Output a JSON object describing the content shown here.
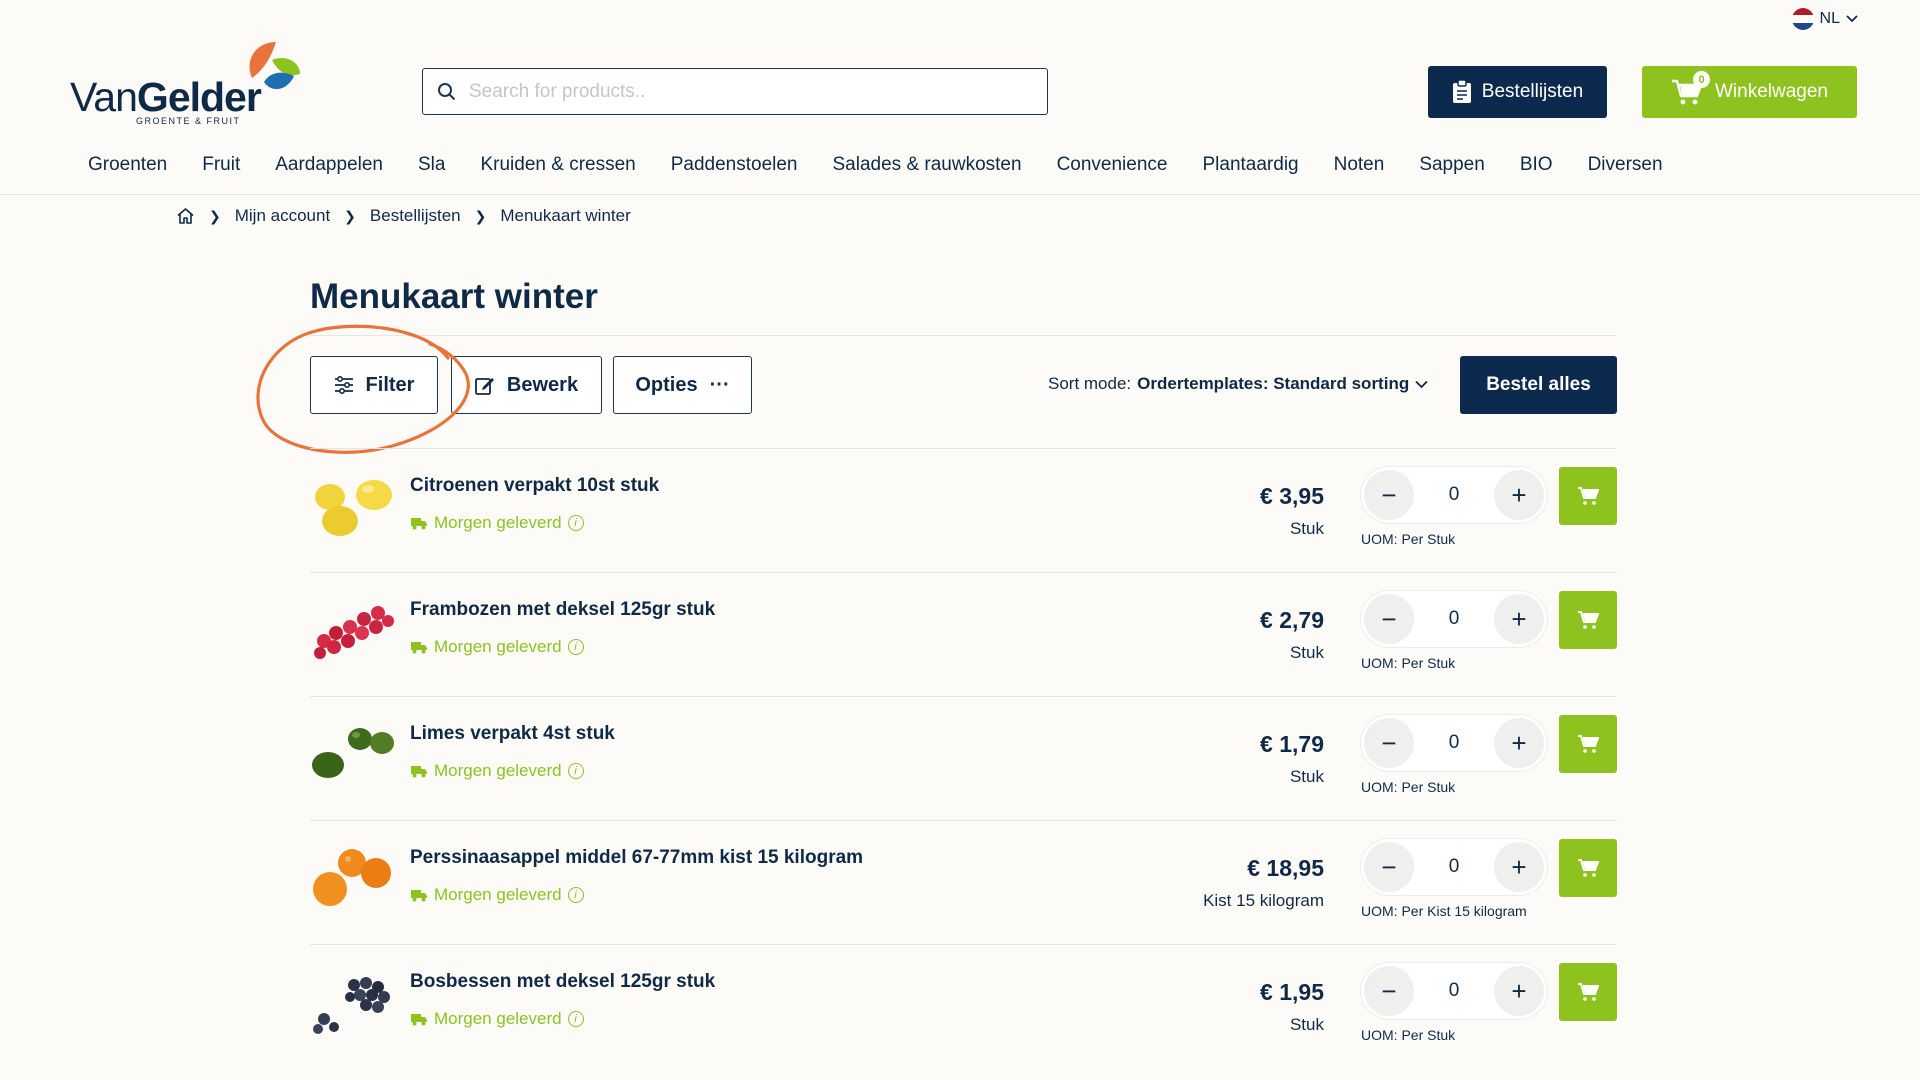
{
  "header": {
    "lang": "NL",
    "logo": {
      "brand_light": "Van",
      "brand_bold": "Gelder",
      "tagline": "GROENTE & FRUIT"
    },
    "search": {
      "placeholder": "Search for products.."
    },
    "orderlists_label": "Bestellijsten",
    "cart_label": "Winkelwagen",
    "cart_count": "0"
  },
  "nav": {
    "items": [
      "Groenten",
      "Fruit",
      "Aardappelen",
      "Sla",
      "Kruiden & cressen",
      "Paddenstoelen",
      "Salades & rauwkosten",
      "Convenience",
      "Plantaardig",
      "Noten",
      "Sappen",
      "BIO",
      "Diversen"
    ]
  },
  "breadcrumb": {
    "items": [
      "Mijn account",
      "Bestellijsten",
      "Menukaart winter"
    ]
  },
  "page": {
    "title": "Menukaart winter",
    "filter_label": "Filter",
    "edit_label": "Bewerk",
    "options_label": "Opties",
    "options_dots": "···",
    "sort_prefix": "Sort mode:",
    "sort_value": "Ordertemplates: Standard sorting",
    "order_all_label": "Bestel alles"
  },
  "products": [
    {
      "name": "Citroenen verpakt 10st stuk",
      "delivery": "Morgen geleverd",
      "price": "€ 3,95",
      "unit": "Stuk",
      "qty": "0",
      "uom": "UOM: Per Stuk"
    },
    {
      "name": "Frambozen met deksel 125gr stuk",
      "delivery": "Morgen geleverd",
      "price": "€ 2,79",
      "unit": "Stuk",
      "qty": "0",
      "uom": "UOM: Per Stuk"
    },
    {
      "name": "Limes verpakt 4st stuk",
      "delivery": "Morgen geleverd",
      "price": "€ 1,79",
      "unit": "Stuk",
      "qty": "0",
      "uom": "UOM: Per Stuk"
    },
    {
      "name": "Perssinaasappel middel 67-77mm kist 15 kilogram",
      "delivery": "Morgen geleverd",
      "price": "€ 18,95",
      "unit": "Kist 15 kilogram",
      "qty": "0",
      "uom": "UOM: Per Kist 15 kilogram"
    },
    {
      "name": "Bosbessen met deksel 125gr stuk",
      "delivery": "Morgen geleverd",
      "price": "€ 1,95",
      "unit": "Stuk",
      "qty": "0",
      "uom": "UOM: Per Stuk"
    }
  ],
  "icons": {
    "search": "search-icon",
    "clipboard": "clipboard-icon",
    "cart": "cart-icon",
    "home": "home-icon",
    "filter": "sliders-icon",
    "edit": "edit-icon",
    "truck": "truck-icon",
    "info": "info-icon",
    "chevron": "chevron-down-icon"
  },
  "colors": {
    "navy": "#0c2a4e",
    "green": "#8dc21f",
    "annotation": "#e8743b",
    "background": "#fcfbf8"
  }
}
